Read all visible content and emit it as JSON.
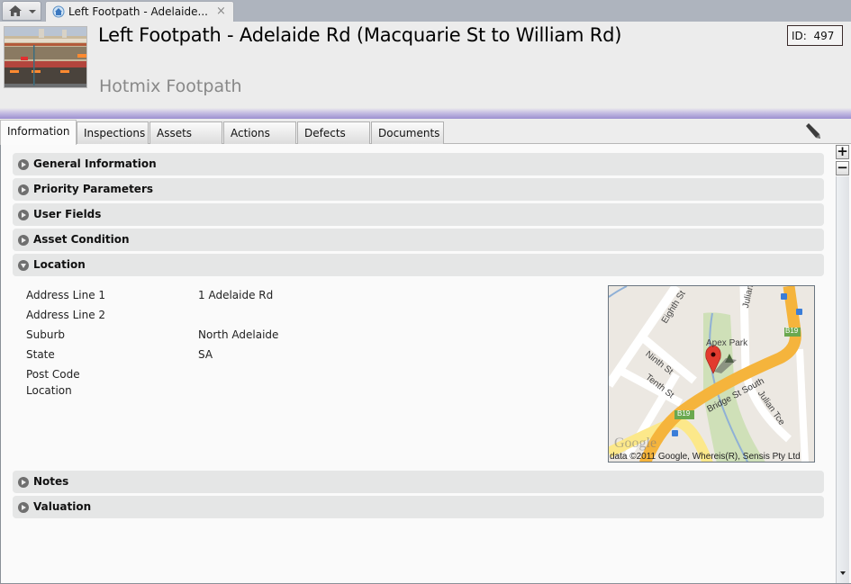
{
  "browser_tab": {
    "home_icon": "home-icon",
    "dropdown_icon": "chevron-down-icon",
    "label": "Left Footpath - Adelaide...",
    "close_label": "×"
  },
  "header": {
    "title": "Left Footpath - Adelaide Rd (Macquarie St to William Rd)",
    "subtitle": "Hotmix Footpath",
    "id_label": "ID:  497"
  },
  "tabs": [
    {
      "label": "Information",
      "active": true
    },
    {
      "label": "Inspections",
      "active": false
    },
    {
      "label": "Assets",
      "active": false
    },
    {
      "label": "Actions",
      "active": false
    },
    {
      "label": "Defects",
      "active": false
    },
    {
      "label": "Documents",
      "active": false
    }
  ],
  "toolbar": {
    "edit_icon": "pencil-icon",
    "zoom_in": "+",
    "zoom_out": "−"
  },
  "sections": [
    {
      "label": "General Information",
      "expanded": false
    },
    {
      "label": "Priority Parameters",
      "expanded": false
    },
    {
      "label": "User Fields",
      "expanded": false
    },
    {
      "label": "Asset Condition",
      "expanded": false
    },
    {
      "label": "Location",
      "expanded": true
    },
    {
      "label": "Notes",
      "expanded": false
    },
    {
      "label": "Valuation",
      "expanded": false
    }
  ],
  "location": {
    "fields": [
      {
        "label": "Address Line 1",
        "value": "1 Adelaide Rd"
      },
      {
        "label": "Address Line 2",
        "value": ""
      },
      {
        "label": "Suburb",
        "value": "North Adelaide"
      },
      {
        "label": "State",
        "value": "SA"
      },
      {
        "label": "Post Code",
        "value": ""
      },
      {
        "label": "Location",
        "value": ""
      }
    ],
    "map": {
      "labels": {
        "eighth": "Eighth St",
        "ninth": "Ninth St",
        "tenth": "Tenth St",
        "bridge": "Bridge St South",
        "julian_tce": "Julian Tce",
        "julian": "Julian",
        "park": "Apex Park",
        "route1": "B19",
        "route2": "B19",
        "logo": "Google"
      },
      "attribution": "data ©2011 Google, Whereis(R), Sensis Pty Ltd"
    }
  }
}
